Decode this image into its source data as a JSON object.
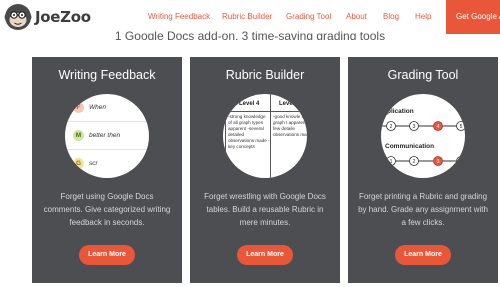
{
  "header": {
    "logo_text": "JoeZoo",
    "nav": [
      "Writing Feedback",
      "Rubric Builder",
      "Grading Tool",
      "About",
      "Blog",
      "Help"
    ],
    "cta_label": "Get Google A"
  },
  "subtitle": "1 Google Docs add-on, 3 time-saving grading tools",
  "cards": [
    {
      "title": "Writing Feedback",
      "description": "Forget using Google Docs comments. Give categorized writing feedback in seconds.",
      "button": "Learn More",
      "preview": {
        "rows": [
          {
            "badge": "F",
            "text": "When",
            "badge_color": "#f5c7b8",
            "badge_text_color": "#d4553a"
          },
          {
            "badge": "M",
            "text": "better then",
            "badge_color": "#cfe4a8",
            "badge_text_color": "#4a6b12"
          },
          {
            "badge": "G",
            "text": "scr",
            "badge_color": "#f4e3a0",
            "badge_text_color": "#8a6e10"
          }
        ]
      }
    },
    {
      "title": "Rubric Builder",
      "description": "Forget wrestling with Google Docs tables. Build a reusable Rubric in mere minutes.",
      "button": "Learn More",
      "preview": {
        "col1_head": "Level 4",
        "col2_head": "Level",
        "col1_text": "-strong knowledge of all graph types apparent -several detailed observations made -key concepts",
        "col2_text": "-good knowle of all graph t apparent -a few detaile observations made"
      }
    },
    {
      "title": "Grading Tool",
      "description": "Forget printing a Rubric and grading by hand. Grade any assignment with a few clicks.",
      "button": "Learn More",
      "preview": {
        "label1": "pplication",
        "label2": "Communication",
        "scale1": [
          "2",
          "3",
          "4",
          "5"
        ],
        "scale2": [
          "1",
          "2",
          "3",
          "4"
        ]
      }
    }
  ]
}
